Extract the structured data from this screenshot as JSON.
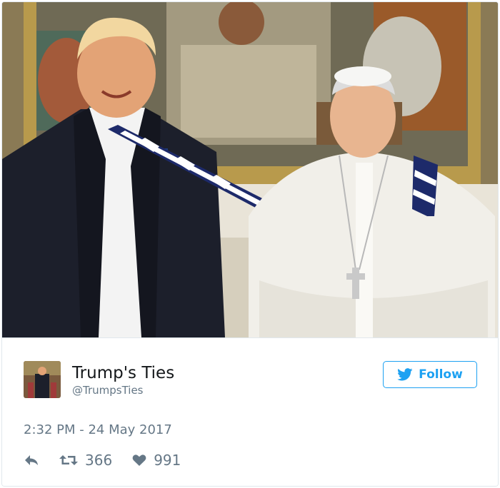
{
  "tweet": {
    "display_name": "Trump's Ties",
    "handle": "@TrumpsTies",
    "follow_label": "Follow",
    "timestamp": "2:32 PM - 24 May 2017",
    "retweets": "366",
    "likes": "991"
  },
  "colors": {
    "twitter_blue": "#1da1f2",
    "secondary_text": "#657786",
    "primary_text": "#14171a",
    "border": "#e1e8ed"
  },
  "icons": [
    "reply-icon",
    "retweet-icon",
    "heart-icon",
    "twitter-bird-icon"
  ]
}
